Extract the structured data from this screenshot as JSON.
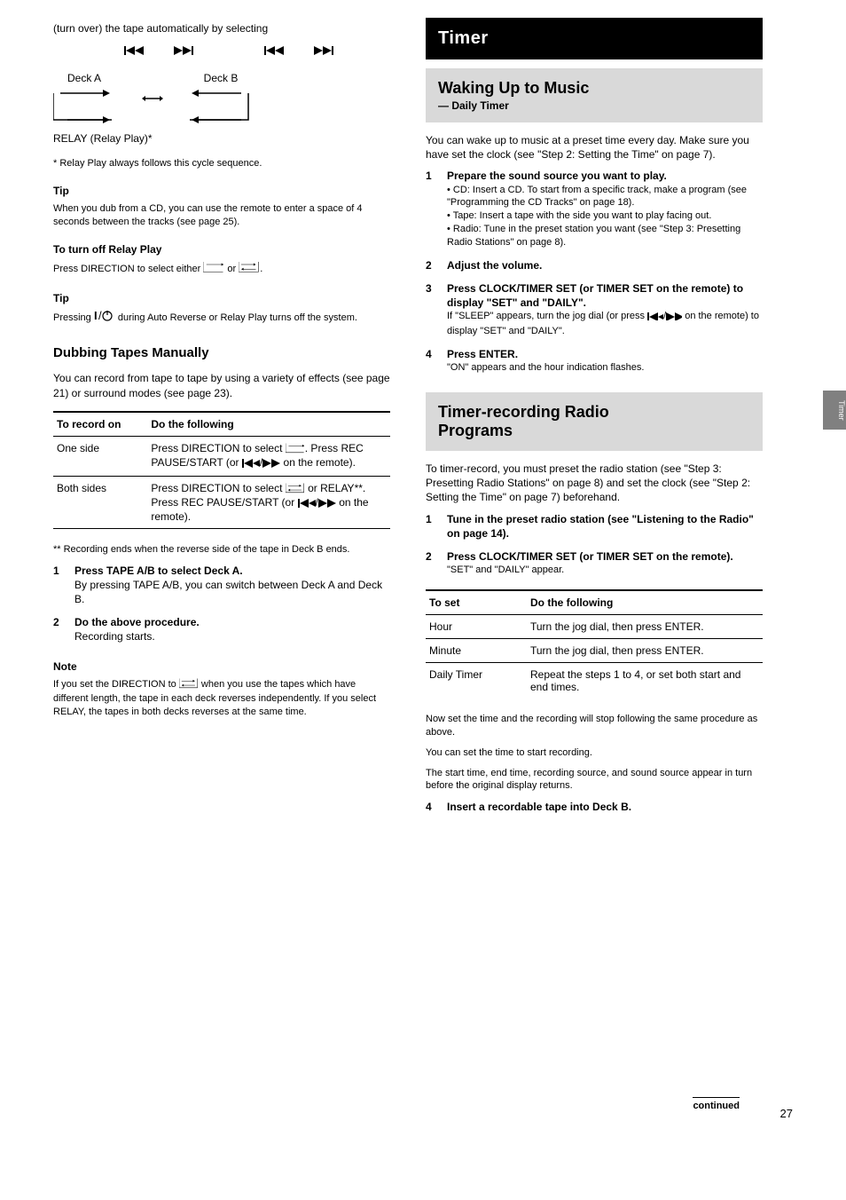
{
  "left": {
    "intro": "(turn over) the tape automatically by selecting",
    "diagram": {
      "deckA": "Deck A",
      "deckB": "Deck B",
      "relay": "RELAY (Relay Play)*"
    },
    "footnote_star": "* Relay Play always follows this cycle sequence.",
    "tip1_hd": "Tip",
    "tip1_ln1": "When you dub from a CD, you can use the remote to enter a space of 4 seconds between the tracks (see page 25).",
    "tip2_hd": "To turn off Relay Play",
    "tip2_ln": "Press DIRECTION to select either       or       .",
    "tip3_hd": "Tip",
    "tip3_ln": "Pressing       during Auto Reverse or Relay Play turns off the system.",
    "dubbing_hd": "Dubbing Tapes Manually",
    "dub_intro": "You can record from tape to tape by using a variety of effects (see page 21) or surround modes (see page 23).",
    "table1": {
      "h1": "To record on",
      "h2": "Do the following",
      "r1a": "One side",
      "r1b": "Press DIRECTION to select      . Press REC PAUSE/START (or       /       on the remote).",
      "r2a": "Both sides",
      "r2b": "Press DIRECTION to select        or RELAY**. Press REC PAUSE/START (or       /       on the remote).",
      "foot": "** Recording ends when the reverse side of the tape in Deck B ends."
    },
    "s1_num": "1",
    "s1_hd": "Press TAPE A/B to select Deck A.",
    "s1_ln": "By pressing TAPE A/B, you can switch between Deck A and Deck B.",
    "s2_num": "2",
    "s2_hd": "Do the above procedure.",
    "s2_ln": "Recording starts.",
    "note_hd": "Note",
    "note_ln": "If you set the DIRECTION to       when you use the",
    "note_ln2": "tapes which have different length, the tape in each deck reverses independently. If you select RELAY, the tapes in both decks reverses at the same time."
  },
  "right": {
    "timer_black": "Timer",
    "wake_hd": "Waking Up to Music",
    "wake_sub": "— Daily Timer",
    "wake_p1": "You can wake up to music at a preset time every day. Make sure you have set the clock (see \"Step 2: Setting the Time\" on page 7).",
    "s1_num": "1",
    "s1": "Prepare the sound source you want to play.",
    "s1_b1": "• CD: Insert a CD. To start from a specific track, make a program (see \"Programming the CD Tracks\" on page 18).",
    "s1_b2": "• Tape: Insert a tape with the side you want to play facing out.",
    "s1_b3": "• Radio: Tune in the preset station you want (see \"Step 3: Presetting Radio Stations\" on page 8).",
    "s2_num": "2",
    "s2": "Adjust the volume.",
    "s3_num": "3",
    "s3": "Press CLOCK/TIMER SET (or TIMER SET on the remote) to display \"SET\" and \"DAILY\".",
    "s3_ln": "If \"SLEEP\" appears, turn the jog dial (or press       /       on the remote) to display \"SET\" and \"DAILY\".",
    "s4_num": "4",
    "s4": "Press ENTER.",
    "s4_ln": "\"ON\" appears and the hour indication flashes.",
    "grey_rec_hd1": "Timer-recording Radio",
    "grey_rec_hd2": "Programs",
    "rec_p1": "To timer-record, you must preset the radio station (see \"Step 3: Presetting Radio Stations\" on page 8) and set the clock (see \"Step 2: Setting the Time\" on page 7) beforehand.",
    "r_s1_num": "1",
    "r_s1": "Tune in the preset radio station (see \"Listening to the Radio\" on page 14).",
    "r_s2_num": "2",
    "r_s2": "Press CLOCK/TIMER SET (or TIMER SET on the remote).",
    "r_s2_ln": "\"SET\" and \"DAILY\" appear.",
    "table2": {
      "h1": "To set",
      "h2": "Do the following",
      "r1a": "Hour",
      "r1b": "Turn the jog dial, then press ENTER.",
      "r2a": "Minute",
      "r2b": "Turn the jog dial, then press ENTER.",
      "r3a": "Daily Timer",
      "r3b": "Repeat the steps 1 to 4, or set both start and end times."
    },
    "rec_p2": "Now set the time and the recording will stop following the same procedure as above.",
    "rec_p3": "You can set the time to start recording.",
    "rec_p4": "The start time, end time, recording source, and sound source appear in turn before the original display returns.",
    "r_s4_num": "4",
    "r_s4_ln": "Insert a recordable tape into Deck B."
  },
  "footer": {
    "continued": "continued",
    "pagenum": "27",
    "sidetab": "Timer"
  }
}
